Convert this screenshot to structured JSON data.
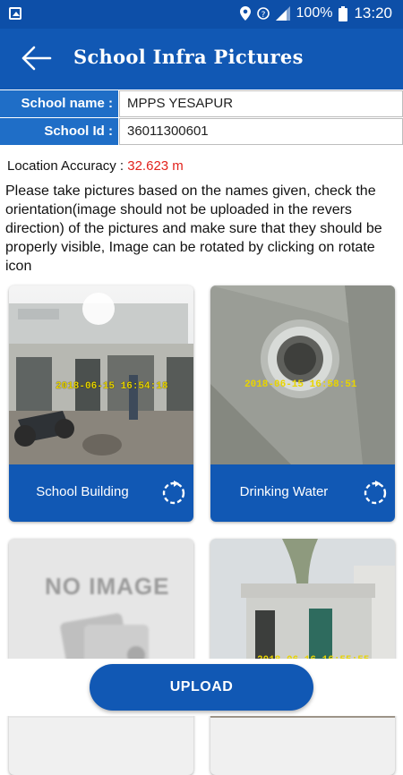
{
  "status_bar": {
    "battery": "100%",
    "time": "13:20",
    "icons": [
      "gallery-icon",
      "location-icon",
      "wifi-icon",
      "signal-icon",
      "battery-icon"
    ]
  },
  "app_bar": {
    "title": "School Infra Pictures",
    "back_icon": "arrow-left-icon"
  },
  "school": {
    "name_label": "School name :",
    "name_value": "MPPS YESAPUR",
    "id_label": "School Id :",
    "id_value": "36011300601"
  },
  "location": {
    "label": "Location Accuracy : ",
    "value": "32.623 m",
    "value_color": "#e2221c"
  },
  "instructions": "Please take pictures based on the names given, check the orientation(image should not be uploaded in the revers direction) of the pictures and make sure that they should be properly visible, Image can be rotated by clicking on rotate icon",
  "cards": [
    {
      "label": "School Building",
      "stamp": "2018-06-15 16:54:18"
    },
    {
      "label": "Drinking Water",
      "stamp": "2018-06-15 16:58:51"
    },
    {
      "placeholder": "NO IMAGE"
    },
    {
      "stamp": "2018-06-16 16:55:55"
    }
  ],
  "upload_label": "UPLOAD",
  "colors": {
    "primary": "#1158b4",
    "status_bar": "#0d4fa8",
    "label_bg": "#1f6ec7"
  }
}
